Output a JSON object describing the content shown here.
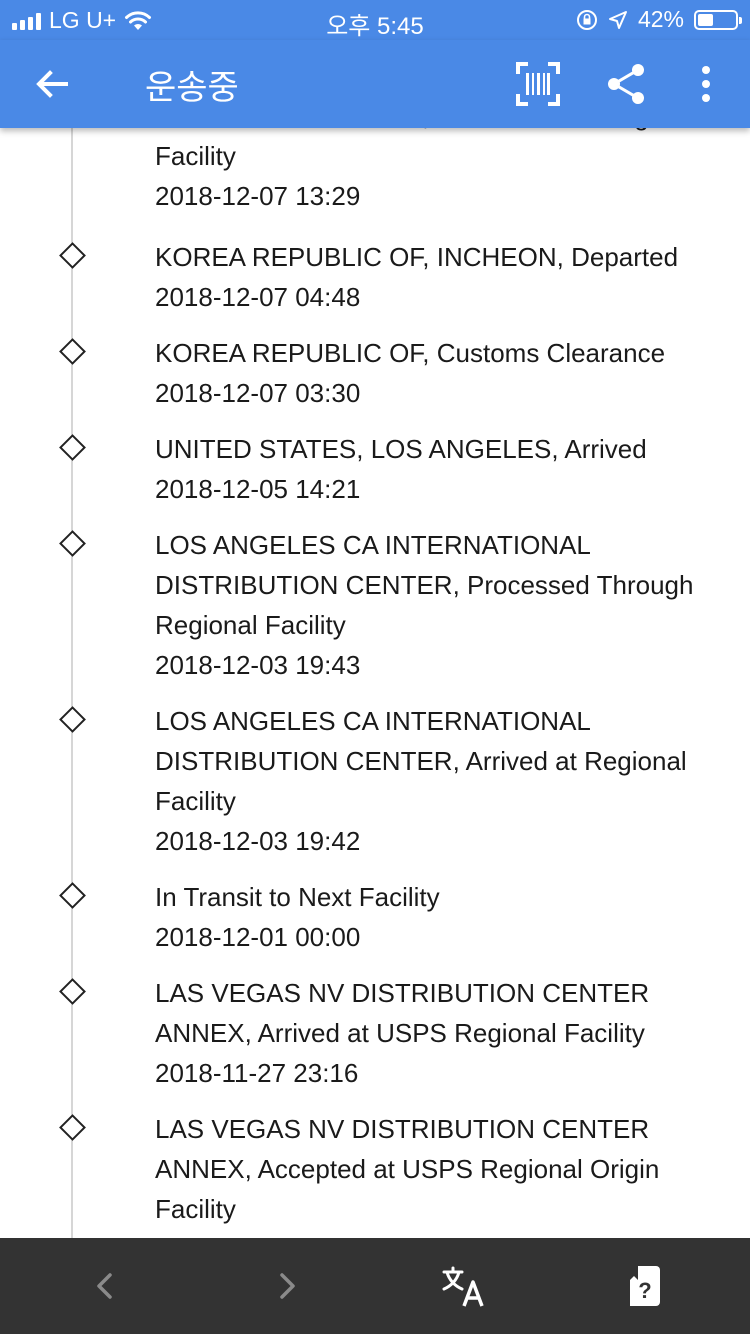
{
  "status_bar": {
    "carrier": "LG U+",
    "time": "오후 5:45",
    "battery_percent": "42%",
    "battery_level": 0.42
  },
  "app_bar": {
    "title": "운송중",
    "back_icon": "arrow-left-icon",
    "barcode_icon": "barcode-scan-icon",
    "share_icon": "share-icon",
    "more_icon": "more-vert-icon"
  },
  "events": [
    {
      "text": "KOREA REPUBLIC OF, Processed Through Facility",
      "datetime": "2018-12-07 13:29"
    },
    {
      "text": "KOREA REPUBLIC OF, INCHEON, Departed",
      "datetime": "2018-12-07 04:48"
    },
    {
      "text": "KOREA REPUBLIC OF, Customs Clearance",
      "datetime": "2018-12-07 03:30"
    },
    {
      "text": "UNITED STATES, LOS ANGELES, Arrived",
      "datetime": "2018-12-05 14:21"
    },
    {
      "text": "LOS ANGELES CA INTERNATIONAL DISTRIBUTION CENTER, Processed Through Regional Facility",
      "datetime": "2018-12-03 19:43"
    },
    {
      "text": "LOS ANGELES CA INTERNATIONAL DISTRIBUTION CENTER, Arrived at Regional Facility",
      "datetime": "2018-12-03 19:42"
    },
    {
      "text": "In Transit to Next Facility",
      "datetime": "2018-12-01 00:00"
    },
    {
      "text": "LAS VEGAS NV DISTRIBUTION CENTER ANNEX, Arrived at USPS Regional Facility",
      "datetime": "2018-11-27 23:16"
    },
    {
      "text": "LAS VEGAS NV DISTRIBUTION CENTER ANNEX, Accepted at USPS Regional Origin Facility",
      "datetime": ""
    }
  ],
  "bottom_bar": {
    "back_icon": "chevron-left-icon",
    "forward_icon": "chevron-right-icon",
    "translate_icon": "translate-icon",
    "help_icon": "help-book-icon"
  },
  "colors": {
    "primary": "#4a89e6",
    "bottom_bar": "#333333",
    "text": "#1a1a1a",
    "timeline": "#d6d6d6"
  }
}
